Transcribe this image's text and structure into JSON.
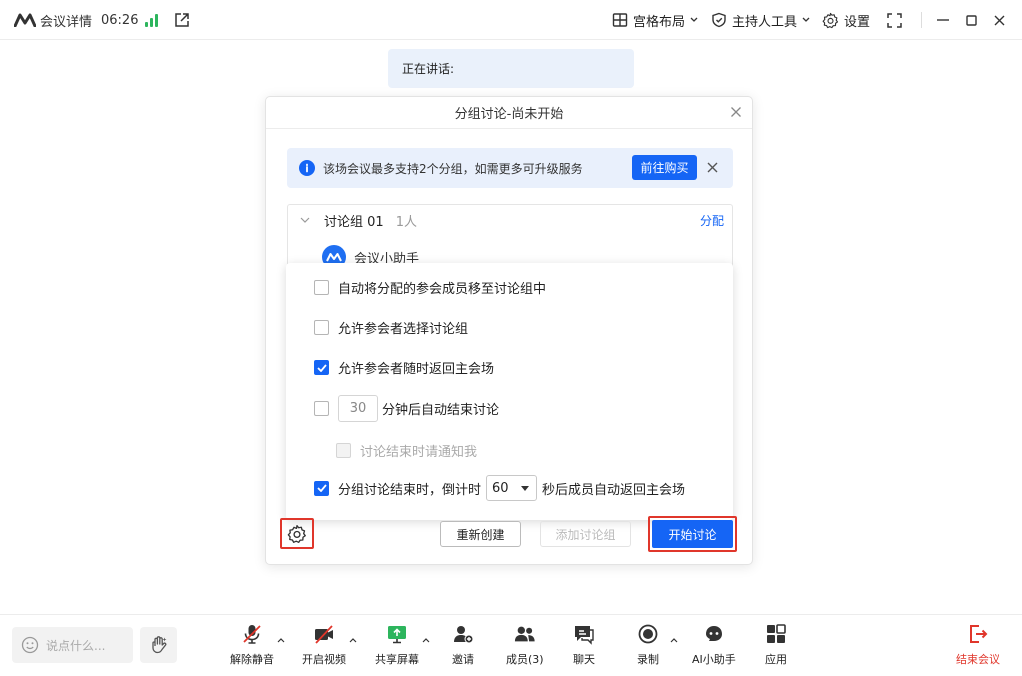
{
  "topbar": {
    "title": "会议详情",
    "timer": "06:26",
    "grid_layout": "宫格布局",
    "host_tools": "主持人工具",
    "settings": "设置"
  },
  "speaking": {
    "label": "正在讲话:"
  },
  "dialog": {
    "title": "分组讨论-尚未开始",
    "notice": {
      "text": "该场会议最多支持2个分组，如需更多可升级服务",
      "buy_button": "前往购买"
    },
    "group": {
      "name": "讨论组 01",
      "count": "1人",
      "assign_link": "分配",
      "member": "会议小助手"
    },
    "options": {
      "auto_move": {
        "label": "自动将分配的参会成员移至讨论组中",
        "checked": false
      },
      "allow_choose": {
        "label": "允许参会者选择讨论组",
        "checked": false
      },
      "allow_return": {
        "label": "允许参会者随时返回主会场",
        "checked": true
      },
      "auto_end": {
        "value": "30",
        "label": "分钟后自动结束讨论",
        "checked": false
      },
      "notify_me": {
        "label": "讨论结束时请通知我",
        "checked": false,
        "disabled": true
      },
      "countdown": {
        "prefix": "分组讨论结束时，倒计时",
        "value": "60",
        "suffix": "秒后成员自动返回主会场",
        "checked": true
      }
    },
    "footer": {
      "recreate": "重新创建",
      "add_group": "添加讨论组",
      "start": "开始讨论"
    }
  },
  "bottombar": {
    "chat_placeholder": "说点什么...",
    "tools": {
      "unmute": "解除静音",
      "video": "开启视频",
      "share": "共享屏幕",
      "invite": "邀请",
      "members": "成员(3)",
      "chat": "聊天",
      "record": "录制",
      "ai": "AI小助手",
      "apps": "应用",
      "end": "结束会议"
    }
  },
  "colors": {
    "accent": "#1565f5",
    "danger": "#e0362b",
    "signal": "#2db55d"
  }
}
